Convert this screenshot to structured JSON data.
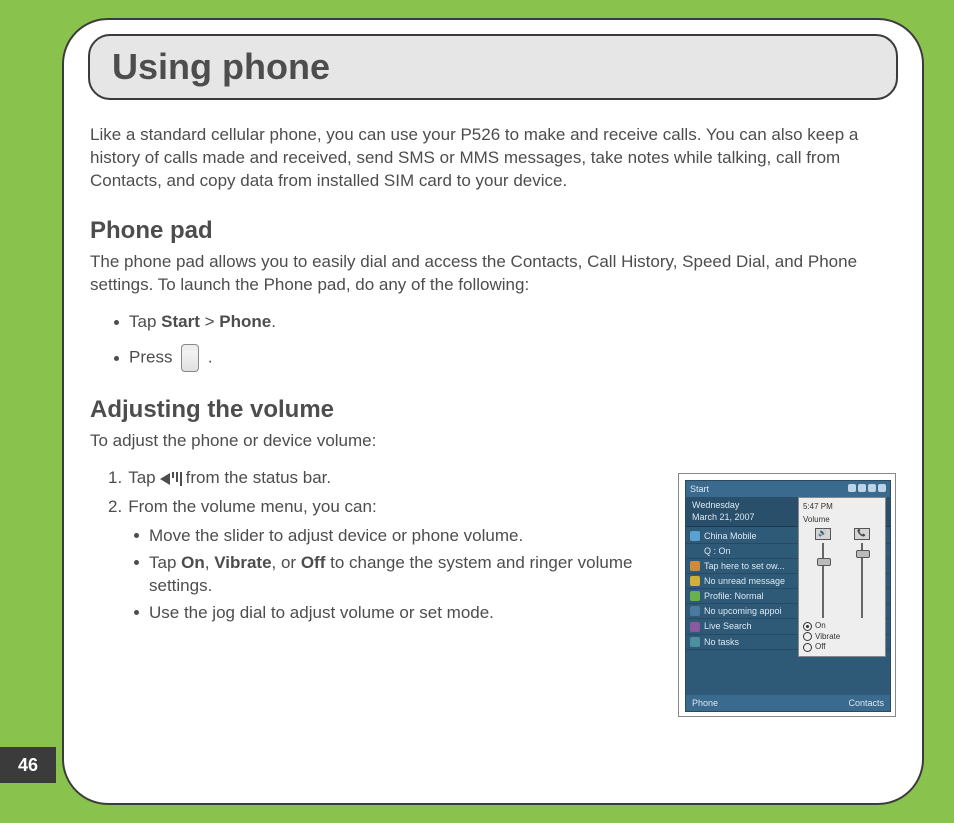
{
  "page_number": "46",
  "header": {
    "title": "Using phone"
  },
  "intro": "Like a standard cellular phone, you can use your P526 to make and receive calls. You can also keep a history of calls made and received, send SMS or MMS messages, take notes while talking, call from Contacts, and copy data from installed SIM card to your device.",
  "phone_pad": {
    "heading": "Phone pad",
    "desc": "The phone pad allows you to easily dial and access the Contacts, Call History, Speed Dial, and Phone settings. To launch the Phone pad, do any of the following:",
    "b1_prefix": "Tap ",
    "b1_bold1": "Start",
    "b1_mid": " > ",
    "b1_bold2": "Phone",
    "b1_suffix": ".",
    "b2_prefix": "Press ",
    "b2_suffix": "."
  },
  "volume": {
    "heading": "Adjusting the volume",
    "desc": "To adjust the phone or device volume:",
    "step1_num": "1.",
    "step1_a": "Tap ",
    "step1_b": " from the status bar.",
    "step2_num": "2.",
    "step2": "From the volume menu, you can:",
    "s1": "Move the slider to adjust device or phone volume.",
    "s2_a": "Tap ",
    "s2_on": "On",
    "s2_c1": ", ",
    "s2_vib": "Vibrate",
    "s2_c2": ", or ",
    "s2_off": "Off",
    "s2_b": " to change the system and ringer volume settings.",
    "s3": "Use the jog dial to adjust volume or set mode."
  },
  "screenshot": {
    "start": "Start",
    "time": "5:47 PM",
    "date_line1": "Wednesday",
    "date_line2": "March 21, 2007",
    "rows": [
      "China Mobile",
      "Q : On",
      "Tap here to set ow...",
      "No unread message",
      "Profile: Normal",
      "No upcoming appoi",
      "Live Search",
      "No tasks"
    ],
    "softkey_left": "Phone",
    "softkey_right": "Contacts",
    "vol_title": "Volume",
    "opt_on": "On",
    "opt_vibrate": "Vibrate",
    "opt_off": "Off"
  }
}
